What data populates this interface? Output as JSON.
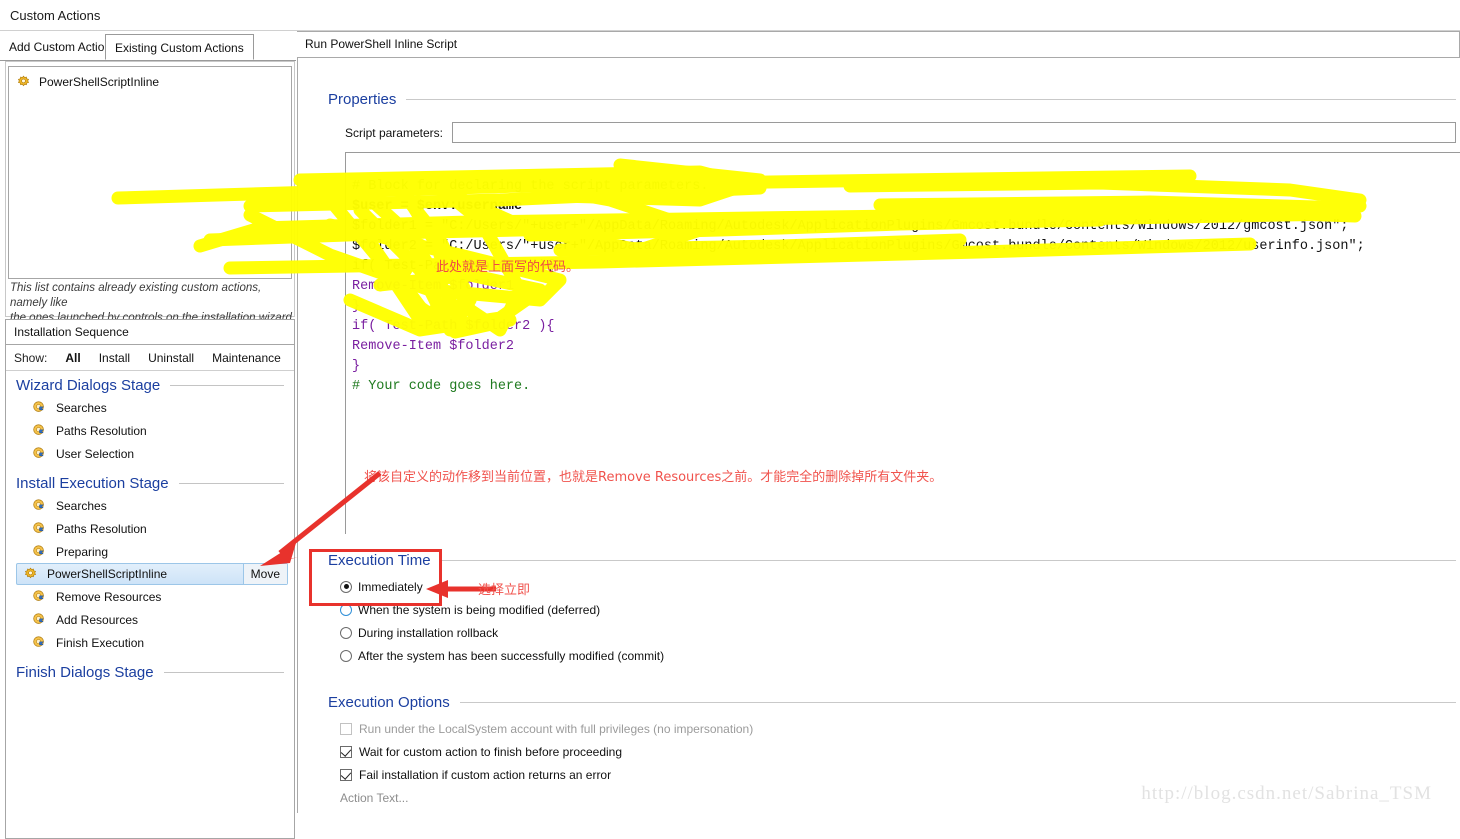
{
  "window": {
    "title": "Custom Actions"
  },
  "tabs": [
    {
      "label": "Add Custom Action",
      "active": false
    },
    {
      "label": "Existing Custom Actions",
      "active": true
    }
  ],
  "existing_actions": {
    "items": [
      {
        "label": "PowerShellScriptInline",
        "icon": "gear-icon"
      }
    ],
    "hint_line1": "This list contains already existing custom actions, namely like",
    "hint_line2": "the ones launched by controls on the installation wizard."
  },
  "installation_sequence": {
    "header": "Installation Sequence",
    "show_label": "Show:",
    "filters": [
      {
        "label": "All",
        "selected": true
      },
      {
        "label": "Install",
        "selected": false
      },
      {
        "label": "Uninstall",
        "selected": false
      },
      {
        "label": "Maintenance",
        "selected": false
      }
    ],
    "stages": [
      {
        "title": "Wizard Dialogs Stage",
        "items": [
          {
            "label": "Searches",
            "icon": "action-arrow-icon",
            "selected": false
          },
          {
            "label": "Paths Resolution",
            "icon": "action-arrow-icon",
            "selected": false
          },
          {
            "label": "User Selection",
            "icon": "action-arrow-icon",
            "selected": false
          }
        ]
      },
      {
        "title": "Install Execution Stage",
        "items": [
          {
            "label": "Searches",
            "icon": "action-arrow-icon",
            "selected": false
          },
          {
            "label": "Paths Resolution",
            "icon": "action-arrow-icon",
            "selected": false
          },
          {
            "label": "Preparing",
            "icon": "action-arrow-icon",
            "selected": false
          },
          {
            "label": "PowerShellScriptInline",
            "icon": "gear-icon",
            "selected": true,
            "button": "Move"
          },
          {
            "label": "Remove Resources",
            "icon": "action-arrow-icon",
            "selected": false
          },
          {
            "label": "Add Resources",
            "icon": "action-arrow-icon",
            "selected": false
          },
          {
            "label": "Finish Execution",
            "icon": "action-arrow-icon",
            "selected": false
          }
        ]
      },
      {
        "title": "Finish Dialogs Stage",
        "items": []
      }
    ]
  },
  "right_panel": {
    "header": "Run PowerShell Inline Script",
    "properties": {
      "title": "Properties",
      "script_parameters_label": "Script parameters:",
      "script_parameters_value": "",
      "script_parameters_placeholder": ""
    },
    "code": {
      "line1_comment": "# Block for declaring the script parameters.",
      "line2": "$user = $env:username",
      "line3": "$folder1 = \"C:/Users/\"+user+\"/AppData/Roaming/Autodesk/ApplicationPlugins/Gmcost.bundle/Contents/Windows/2012/gmcost.json\";",
      "line4": "$folder2 = \"C:/Users/\"+user+\"/AppData/Roaming/Autodesk/ApplicationPlugins/Gmcost.bundle/Contents/Windows/2012/userinfo.json\";",
      "line5": "if( Test-Path $folder1 ){",
      "line6": "Remove-Item $folder1",
      "line7": "}",
      "line8": "if( Test-Path $folder2 ){",
      "line9": "Remove-Item $folder2",
      "line10": "}",
      "line11_comment": "# Your code goes here."
    },
    "execution_time": {
      "title": "Execution Time",
      "options": [
        {
          "label": "Immediately",
          "selected": true
        },
        {
          "label": "When the system is being modified (deferred)",
          "selected": false
        },
        {
          "label": "During installation rollback",
          "selected": false
        },
        {
          "label": "After the system has been successfully modified (commit)",
          "selected": false
        }
      ]
    },
    "execution_options": {
      "title": "Execution Options",
      "options": [
        {
          "label": "Run under the LocalSystem account with full privileges (no impersonation)",
          "checked": false,
          "disabled": true
        },
        {
          "label": "Wait for custom action to finish before proceeding",
          "checked": true,
          "disabled": false
        },
        {
          "label": "Fail installation if custom action returns an error",
          "checked": true,
          "disabled": false
        }
      ],
      "action_text": "Action Text..."
    }
  },
  "annotations": {
    "note_move_action": "将该自定义的动作移到当前位置，也就是Remove Resources之前。才能完全的删除掉所有文件夹。",
    "note_select_immediately": "选择立即",
    "note_code_here": "此处就是上面写的代码。",
    "watermark": "http://blog.csdn.net/Sabrina_TSM"
  },
  "colors": {
    "heading_blue": "#1b3fa0",
    "annotation_red": "#ef4a44",
    "highlighter_yellow": "#ffff00",
    "selection_blue": "#cde3f8"
  }
}
